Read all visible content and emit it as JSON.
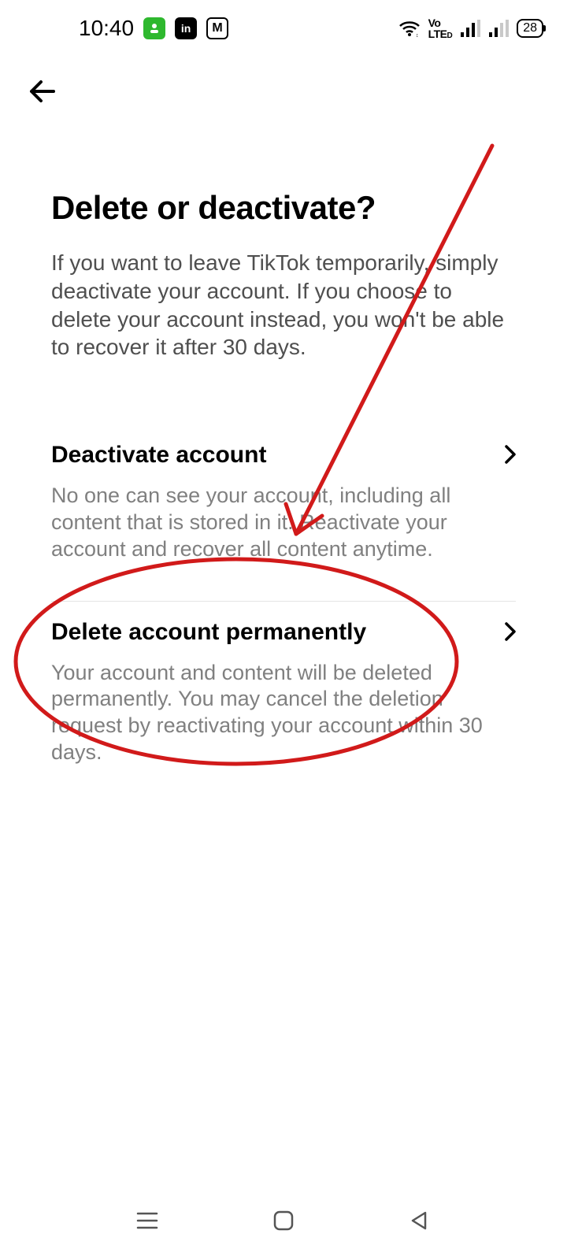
{
  "status_bar": {
    "time": "10:40",
    "volte_label": "Vo LTEo",
    "battery_percent": "28"
  },
  "nav": {
    "back_label": "Back"
  },
  "page": {
    "title": "Delete or deactivate?",
    "description": "If you want to leave TikTok temporarily, simply deactivate your account. If you choose to delete your account instead, you won't be able to recover it after 30 days."
  },
  "options": {
    "deactivate": {
      "title": "Deactivate account",
      "description": "No one can see your account, including all content that is stored in it. Reactivate your account and recover all content anytime."
    },
    "delete": {
      "title": "Delete account permanently",
      "description": "Your account and content will be deleted permanently. You may cancel the deletion request by reactivating your account within 30 days."
    }
  },
  "annotation": {
    "color": "#d11a1a"
  }
}
